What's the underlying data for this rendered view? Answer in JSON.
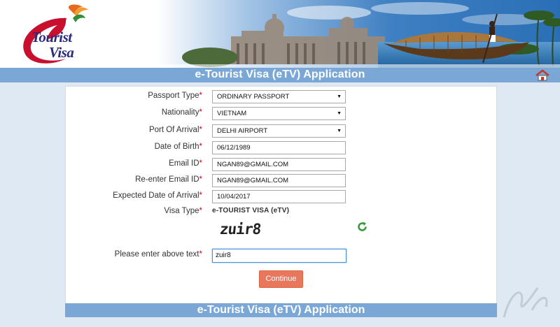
{
  "header": {
    "logo": {
      "line1": "Tourist",
      "line2": "Visa",
      "glyph": "e"
    },
    "title": "e-Tourist Visa (eTV) Application",
    "home_icon": "home-icon"
  },
  "form": {
    "fields": [
      {
        "label": "Passport Type",
        "required": "*",
        "type": "select",
        "value": "ORDINARY PASSPORT"
      },
      {
        "label": "Nationality",
        "required": "*",
        "type": "select",
        "value": "VIETNAM"
      },
      {
        "label": "Port Of Arrival",
        "required": "*",
        "type": "select",
        "value": "DELHI AIRPORT"
      },
      {
        "label": "Date of Birth",
        "required": "*",
        "type": "text",
        "value": "06/12/1989"
      },
      {
        "label": "Email ID",
        "required": "*",
        "type": "text",
        "value": "NGAN89@GMAIL.COM"
      },
      {
        "label": "Re-enter Email ID",
        "required": "*",
        "type": "text",
        "value": "NGAN89@GMAIL.COM"
      },
      {
        "label": "Expected Date of Arrival",
        "required": "*",
        "type": "text",
        "value": "10/04/2017"
      },
      {
        "label": "Visa Type",
        "required": "*",
        "type": "static",
        "value": "e-TOURIST VISA (eTV)"
      }
    ],
    "captcha": {
      "image_text": "zuir8",
      "refresh_icon": "refresh-icon",
      "prompt_label": "Please enter above text",
      "required": "*",
      "input_value": "zuir8"
    },
    "continue_label": "Continue"
  },
  "footer": {
    "title": "e-Tourist Visa (eTV) Application"
  },
  "colors": {
    "title_bar": "#7aa7d6",
    "continue_button": "#e8775b",
    "required": "#d0021b",
    "page_bg": "#dfe9f4"
  }
}
